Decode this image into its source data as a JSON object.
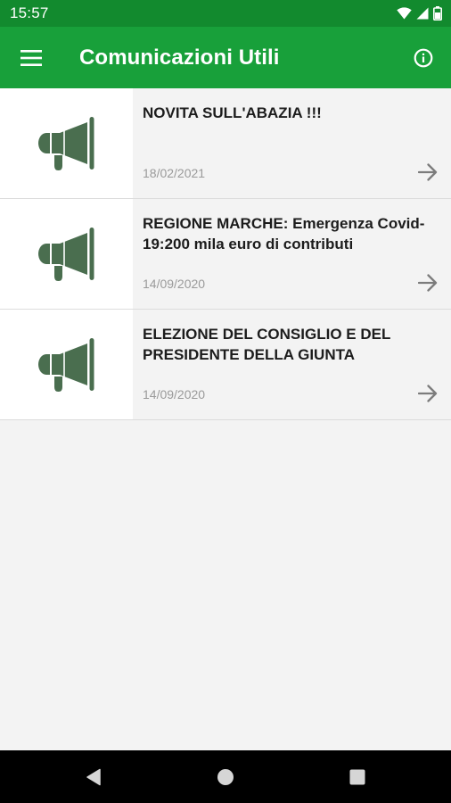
{
  "status_bar": {
    "time": "15:57"
  },
  "app_bar": {
    "title": "Comunicazioni Utili"
  },
  "items": [
    {
      "title": "NOVITA SULL'ABAZIA !!!",
      "date": "18/02/2021",
      "icon": "megaphone-icon"
    },
    {
      "title": "REGIONE MARCHE: Emergenza Covid-19:200 mila euro di contributi",
      "date": "14/09/2020",
      "icon": "megaphone-icon"
    },
    {
      "title": "ELEZIONE DEL CONSIGLIO E DEL PRESIDENTE DELLA GIUNTA",
      "date": "14/09/2020",
      "icon": "megaphone-icon"
    }
  ],
  "colors": {
    "status_bar": "#128a2e",
    "app_bar": "#18a03a",
    "icon": "#4a6e4f",
    "background": "#f3f3f3"
  }
}
